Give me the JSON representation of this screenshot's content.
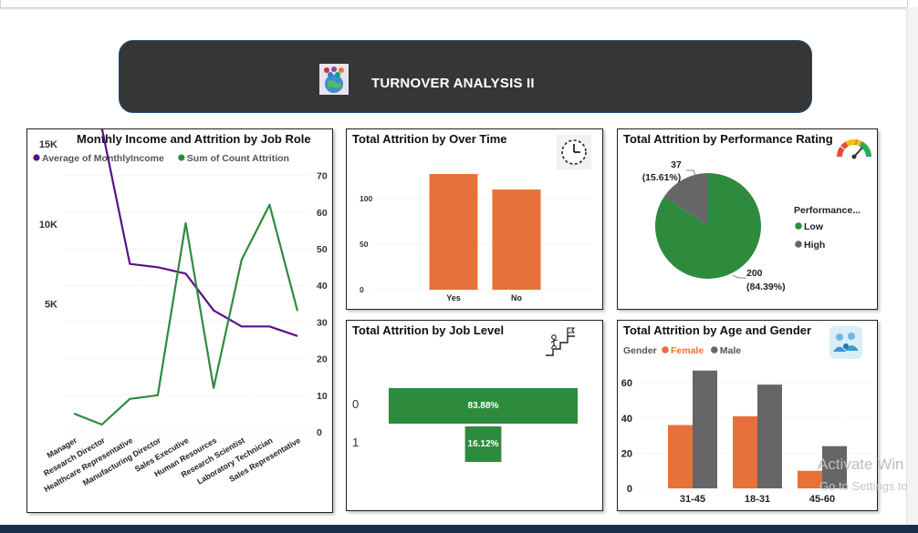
{
  "header": {
    "title": "TURNOVER ANALYSIS II",
    "icon": "people-globe-icon"
  },
  "watermark": {
    "line1": "Activate Win",
    "line2": "Go to Settings to"
  },
  "panels": {
    "income": {
      "title": "Monthly Income and Attrition by Job Role",
      "legend": [
        {
          "label": "Average of MonthlyIncome",
          "color": "#5b0f8a"
        },
        {
          "label": "Sum of Count Attrition",
          "color": "#2e8b3d"
        }
      ]
    },
    "overtime": {
      "title": "Total Attrition by Over Time",
      "icon": "clock-icon"
    },
    "performance": {
      "title": "Total Attrition by Performance Rating",
      "icon": "gauge-icon"
    },
    "joblevel": {
      "title": "Total Attrition by Job Level",
      "icon": "stairs-climb-icon"
    },
    "agegender": {
      "title": "Total Attrition by Age and Gender",
      "icon": "team-icon"
    }
  },
  "chart_data": [
    {
      "type": "line",
      "title": "Monthly Income and Attrition by Job Role",
      "categories": [
        "Manager",
        "Research Director",
        "Healthcare Representative",
        "Manufacturing Director",
        "Sales Executive",
        "Human Resources",
        "Research Scientist",
        "Laboratory Technician",
        "Sales Representative"
      ],
      "series": [
        {
          "name": "Average of MonthlyIncome",
          "axis": "left",
          "color": "#5b0f8a",
          "values": [
            17200,
            16000,
            7500,
            7300,
            6900,
            4600,
            3600,
            3600,
            3000
          ]
        },
        {
          "name": "Sum of Count Attrition",
          "axis": "right",
          "color": "#2e8b3d",
          "values": [
            5,
            2,
            9,
            10,
            57,
            12,
            47,
            62,
            33
          ]
        }
      ],
      "y_left": {
        "ticks": [
          5000,
          10000,
          15000
        ],
        "tick_labels": [
          "5K",
          "10K",
          "15K"
        ]
      },
      "y_right": {
        "ticks": [
          0,
          10,
          20,
          30,
          40,
          50,
          60,
          70
        ],
        "tick_labels": [
          "0",
          "10",
          "20",
          "30",
          "40",
          "50",
          "60",
          "70"
        ]
      },
      "legend": "top-left"
    },
    {
      "type": "bar",
      "title": "Total Attrition by Over Time",
      "categories": [
        "Yes",
        "No"
      ],
      "values": [
        127,
        110
      ],
      "color": "#e8703a",
      "y_ticks": [
        0,
        50,
        100
      ],
      "ylim": [
        0,
        135
      ]
    },
    {
      "type": "pie",
      "title": "Total Attrition by Performance Rating",
      "legend_title": "Performance...",
      "slices": [
        {
          "label": "Low",
          "value": 200,
          "percent_label": "(84.39%)",
          "color": "#2e8b3d"
        },
        {
          "label": "High",
          "value": 37,
          "percent_label": "(15.61%)",
          "color": "#666666"
        }
      ],
      "legend": "right"
    },
    {
      "type": "bar",
      "orientation": "horizontal",
      "title": "Total Attrition by Job Level",
      "categories": [
        "0",
        "1"
      ],
      "values": [
        83.88,
        16.12
      ],
      "value_labels": [
        "83.88%",
        "16.12%"
      ],
      "color": "#2e8b3d"
    },
    {
      "type": "bar",
      "title": "Total Attrition by Age and Gender",
      "legend_title": "Gender",
      "categories": [
        "31-45",
        "18-31",
        "45-60"
      ],
      "series": [
        {
          "name": "Female",
          "color": "#e8703a",
          "values": [
            36,
            41,
            10
          ]
        },
        {
          "name": "Male",
          "color": "#666666",
          "values": [
            67,
            59,
            24
          ]
        }
      ],
      "y_ticks": [
        0,
        20,
        40,
        60
      ],
      "ylim": [
        0,
        70
      ],
      "legend": "top-left"
    }
  ]
}
